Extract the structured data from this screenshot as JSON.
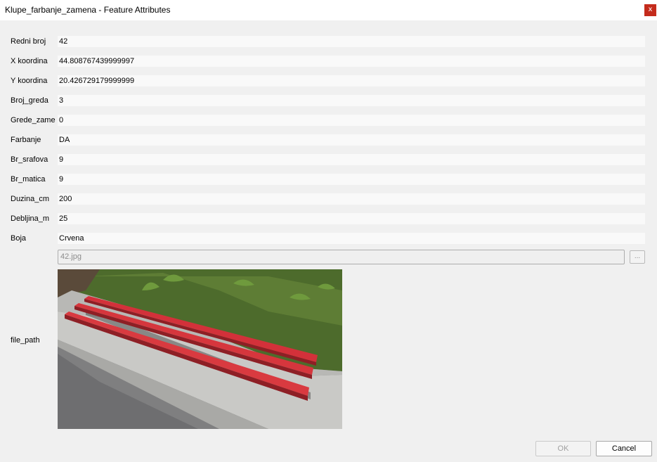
{
  "window": {
    "title": "Klupe_farbanje_zamena - Feature Attributes",
    "close_glyph": "x"
  },
  "fields": [
    {
      "label": "Redni broj",
      "value": "42"
    },
    {
      "label": "X koordina",
      "value": "44.808767439999997"
    },
    {
      "label": "Y koordina",
      "value": "20.426729179999999"
    },
    {
      "label": "Broj_greda",
      "value": "3"
    },
    {
      "label": "Grede_zame",
      "value": "0"
    },
    {
      "label": "Farbanje",
      "value": "DA"
    },
    {
      "label": "Br_srafova",
      "value": "9"
    },
    {
      "label": "Br_matica",
      "value": "9"
    },
    {
      "label": "Duzina_cm",
      "value": "200"
    },
    {
      "label": "Debljina_m",
      "value": "25"
    },
    {
      "label": "Boja",
      "value": "Crvena"
    }
  ],
  "file_path": {
    "label": "file_path",
    "value": "42.jpg",
    "browse_label": "..."
  },
  "photo": {
    "subject": "red wooden bench on concrete ledge",
    "colors": {
      "planks": "#d3313a",
      "concrete": "#c9c9c9",
      "grass": "#4e6a2c",
      "asphalt": "#8a8a8a"
    }
  },
  "buttons": {
    "ok_label": "OK",
    "cancel_label": "Cancel"
  }
}
